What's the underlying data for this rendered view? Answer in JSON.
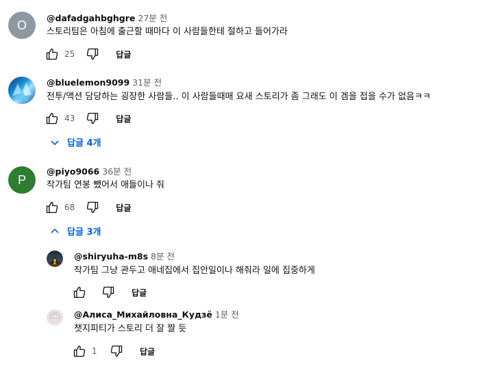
{
  "icons": {
    "like": "thumbs-up-icon",
    "dislike": "thumbs-down-icon",
    "expand": "chevron-down-icon",
    "collapse": "chevron-up-icon"
  },
  "colors": {
    "link_blue": "#065fd4",
    "secondary_text": "#606060",
    "avatar_o": "#8e98a2",
    "avatar_p": "#2e7d32"
  },
  "reply_label": "답글",
  "comments": [
    {
      "avatar_letter": "O",
      "author": "@dafadgahbghgre",
      "time": "27분 전",
      "text": "스토리팀은 아침에 출근할 때마다 이 사람들한테 절하고 들어가라",
      "likes": "25"
    },
    {
      "avatar_letter": "",
      "author": "@bluelemon9099",
      "time": "31분 전",
      "text": "전투/액션 담당하는 굉장한 사람들.. 이 사람들때매 요새 스토리가 좀 그래도 이 겜을 접을 수가 없음ㅋㅋ",
      "likes": "43",
      "replies_toggle": "답글 4개"
    },
    {
      "avatar_letter": "P",
      "author": "@piyo9066",
      "time": "36분 전",
      "text": "작가팀 연봉 뺐어서 애들이나 줘",
      "likes": "68",
      "replies_toggle": "답글 3개"
    }
  ],
  "replies": [
    {
      "author": "@shiryuha-m8s",
      "time": "8분 전",
      "text": "작가팀 그냥 관두고 애네집에서 집안일이나 해줘라 일에 집중하게",
      "likes": ""
    },
    {
      "author": "@Алиса_Михайловна_Кудзё",
      "time": "1분 전",
      "text": "챗지피티가 스토리 더 잘 짤 듯",
      "likes": "1"
    }
  ]
}
